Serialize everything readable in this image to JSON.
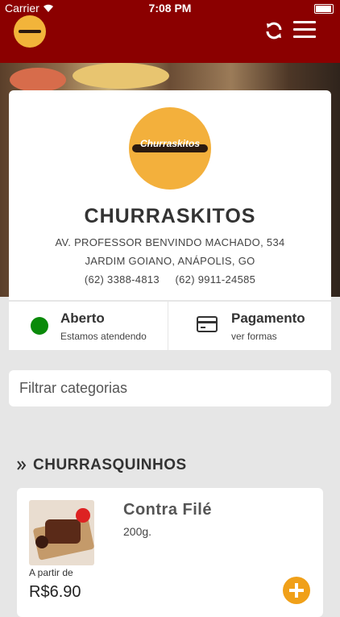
{
  "status_bar": {
    "carrier": "Carrier",
    "time": "7:08 PM"
  },
  "store": {
    "name": "CHURRASKITOS",
    "logo_text": "Churraskitos",
    "address_line1": "AV. PROFESSOR BENVINDO MACHADO, 534",
    "address_line2": "JARDIM GOIANO, ANÁPOLIS, GO",
    "phone1": "(62) 3388-4813",
    "phone2": "(62) 9911-24585"
  },
  "status_info": {
    "title": "Aberto",
    "subtitle": "Estamos atendendo",
    "color": "#0a8a0a"
  },
  "payment_info": {
    "title": "Pagamento",
    "subtitle": "ver formas"
  },
  "filter": {
    "placeholder": "Filtrar categorias"
  },
  "section": {
    "title": "CHURRASQUINHOS"
  },
  "products": [
    {
      "name": "Contra Filé",
      "description": "200g.",
      "price_prefix": "A partir de",
      "price": "R$6.90"
    }
  ],
  "colors": {
    "header": "#8b0000",
    "accent": "#f0a019",
    "brand_yellow": "#f3b03c"
  },
  "icons": [
    "wifi-icon",
    "battery-icon",
    "refresh-icon",
    "menu-icon",
    "credit-card-icon",
    "double-chevron-right-icon",
    "plus-icon"
  ]
}
